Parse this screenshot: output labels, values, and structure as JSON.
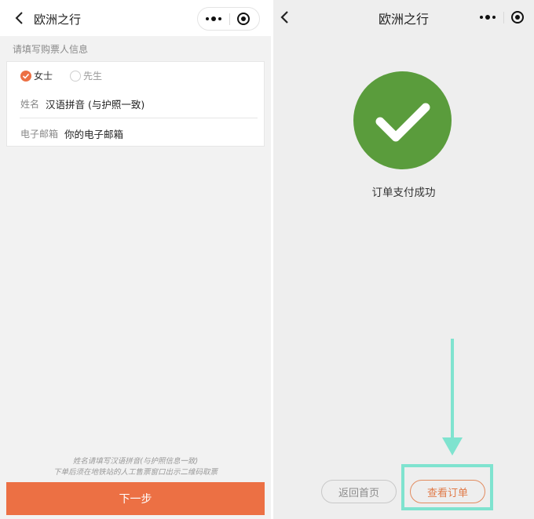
{
  "left_screen": {
    "nav": {
      "title": "欧洲之行"
    },
    "section_title": "请填写购票人信息",
    "gender": {
      "options": [
        "女士",
        "先生"
      ],
      "selected": "女士"
    },
    "fields": {
      "name_label": "姓名",
      "name_placeholder": "汉语拼音 (与护照一致)",
      "email_label": "电子邮箱",
      "email_placeholder": "你的电子邮箱"
    },
    "hints": [
      "姓名请填写汉语拼音(与护照信息一致)",
      "下单后须在地铁站的人工售票窗口出示二维码取票"
    ],
    "next_button": "下一步"
  },
  "right_screen": {
    "nav": {
      "title": "欧洲之行"
    },
    "status_text": "订单支付成功",
    "buttons": {
      "home": "返回首页",
      "view_order": "查看订单"
    }
  },
  "colors": {
    "accent": "#ec7044",
    "success": "#5a9c3c",
    "highlight": "#7fe3cf"
  }
}
